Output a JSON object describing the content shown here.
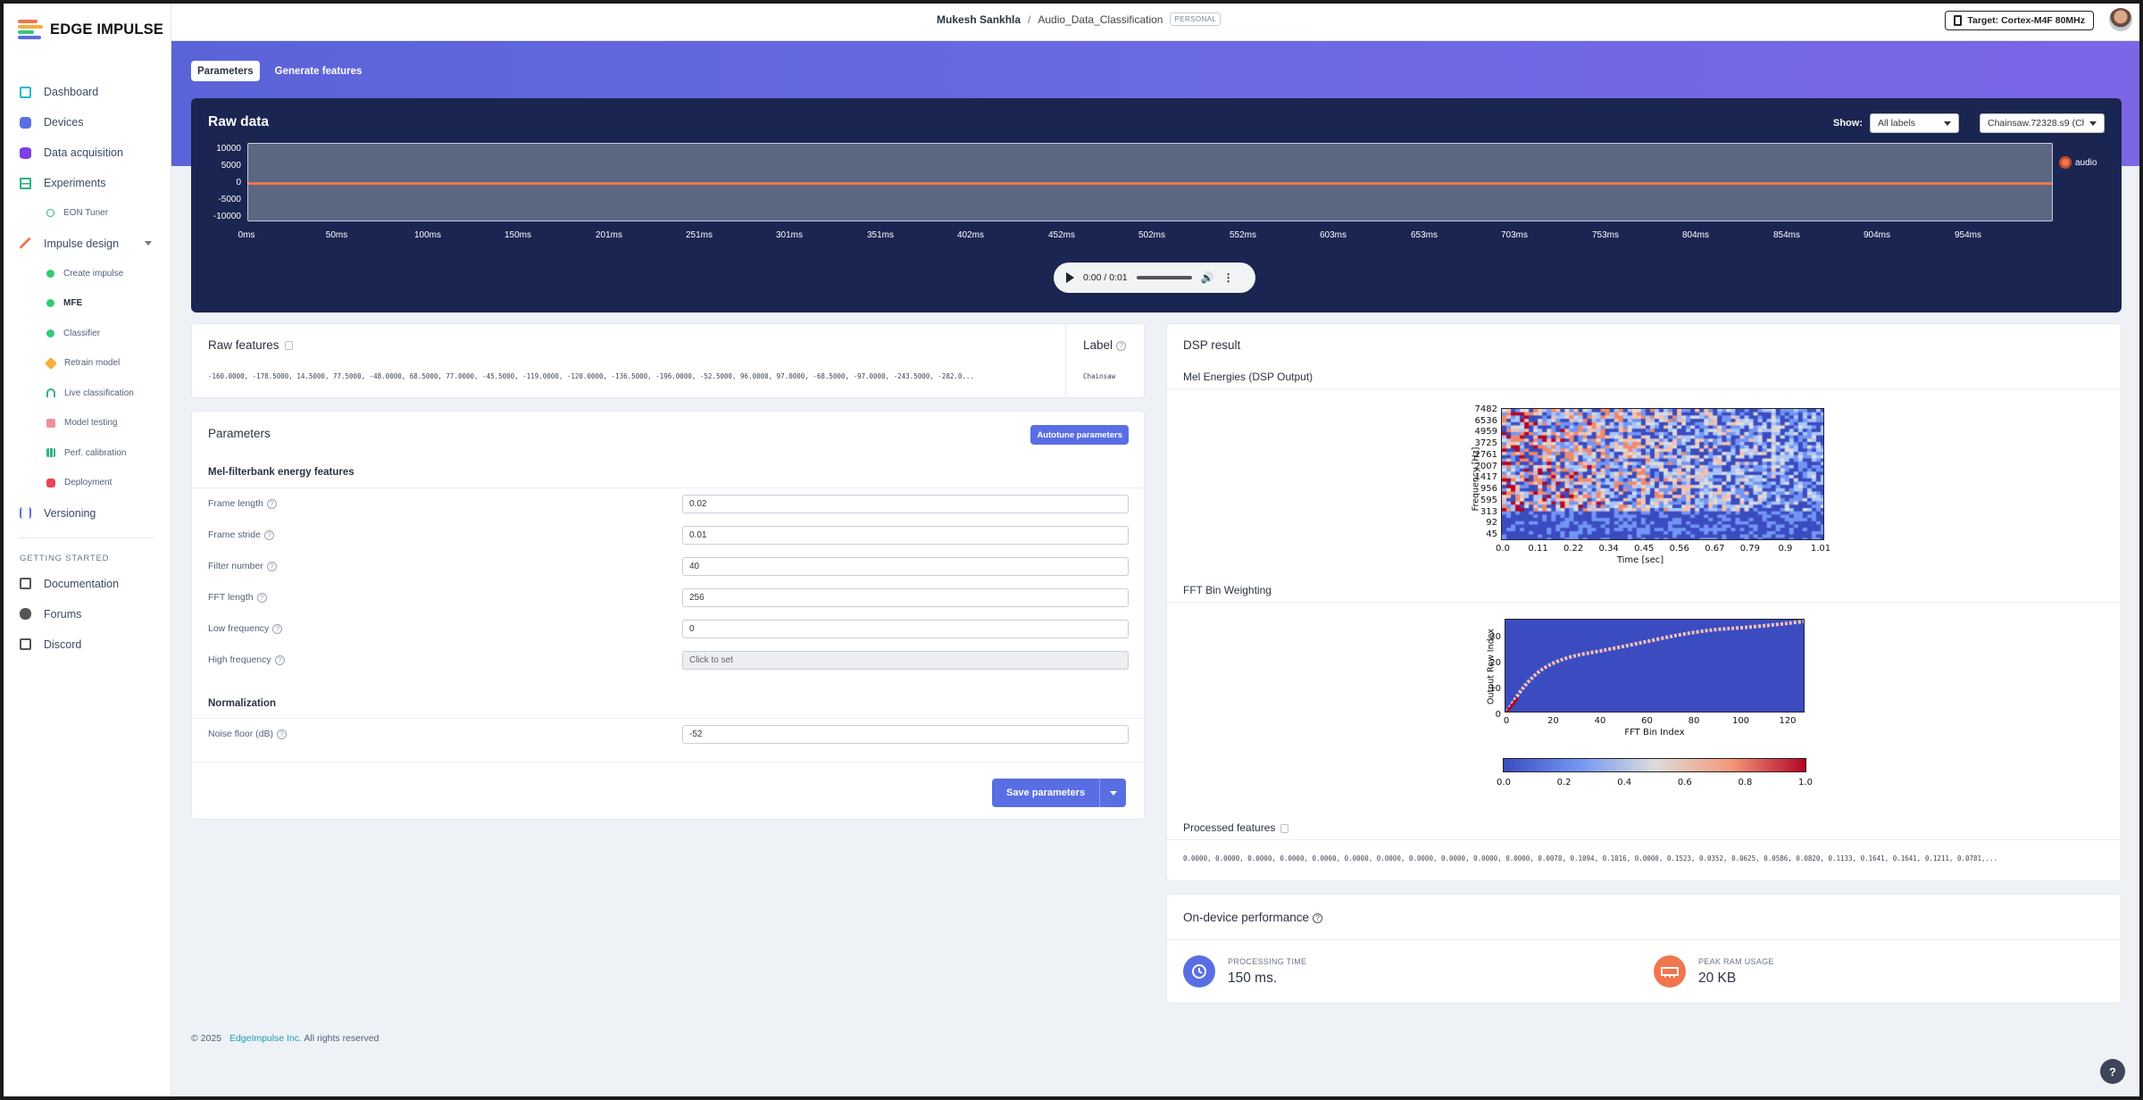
{
  "app": {
    "logo_text": "EDGE IMPULSE",
    "logo_colors": [
      "#f0764e",
      "#f4b03e",
      "#37c87a",
      "#5a6ee3"
    ]
  },
  "sidebar": {
    "items": [
      {
        "label": "Dashboard",
        "icon": "monitor-icon",
        "color": "#22b8cf"
      },
      {
        "label": "Devices",
        "icon": "devices-icon",
        "color": "#5a6ee3"
      },
      {
        "label": "Data acquisition",
        "icon": "database-icon",
        "color": "#7b3fe4"
      },
      {
        "label": "Experiments",
        "icon": "table-icon",
        "color": "#2fb380"
      }
    ],
    "eon": {
      "label": "EON Tuner",
      "icon": "eon-tuner-icon"
    },
    "impulse": {
      "label": "Impulse design",
      "icon": "pulse-icon"
    },
    "impulse_sub": [
      {
        "label": "Create impulse",
        "color": "#37c87a"
      },
      {
        "label": "MFE",
        "color": "#37c87a"
      },
      {
        "label": "Classifier",
        "color": "#37c87a"
      }
    ],
    "other_sub": [
      {
        "label": "Retrain model",
        "color": "#f4b03e"
      },
      {
        "label": "Live classification",
        "color": "#2fb380"
      },
      {
        "label": "Model testing",
        "color": "#f08fa1"
      },
      {
        "label": "Perf. calibration",
        "color": "#2fb380"
      },
      {
        "label": "Deployment",
        "color": "#e8445a"
      }
    ],
    "versioning": "Versioning",
    "getting_started": "GETTING STARTED",
    "links": [
      "Documentation",
      "Forums",
      "Discord"
    ]
  },
  "topbar": {
    "user": "Mukesh Sankhla",
    "separator": "/",
    "project": "Audio_Data_Classification",
    "badge": "PERSONAL",
    "target": "Target: Cortex-M4F 80MHz"
  },
  "tabs": [
    "Parameters",
    "Generate features"
  ],
  "raw_data": {
    "title": "Raw data",
    "show_label": "Show:",
    "show_value": "All labels",
    "sample_value": "Chainsaw.72328.s9 (Ch",
    "y_ticks": [
      "10000",
      "5000",
      "0",
      "-5000",
      "-10000"
    ],
    "x_ticks": [
      "0ms",
      "50ms",
      "100ms",
      "150ms",
      "201ms",
      "251ms",
      "301ms",
      "351ms",
      "402ms",
      "452ms",
      "502ms",
      "552ms",
      "603ms",
      "653ms",
      "703ms",
      "753ms",
      "804ms",
      "854ms",
      "904ms",
      "954ms"
    ],
    "legend": "audio",
    "player_time": "0:00 / 0:01"
  },
  "raw_features": {
    "title": "Raw features",
    "values": "-160.0000, -178.5000, 14.5000, 77.5000, -48.0000, 68.5000, 77.0000, -45.5000, -119.0000, -120.0000, -136.5000, -196.0000, -52.5000, 96.0000, 97.0000, -68.5000, -97.0000, -243.5000, -282.0...",
    "label_title": "Label",
    "label_value": "Chainsaw"
  },
  "parameters": {
    "title": "Parameters",
    "autotune": "Autotune parameters",
    "section1": "Mel-filterbank energy features",
    "fields": [
      {
        "label": "Frame length",
        "value": "0.02"
      },
      {
        "label": "Frame stride",
        "value": "0.01"
      },
      {
        "label": "Filter number",
        "value": "40"
      },
      {
        "label": "FFT length",
        "value": "256"
      },
      {
        "label": "Low frequency",
        "value": "0"
      },
      {
        "label": "High frequency",
        "value": "Click to set"
      }
    ],
    "section2": "Normalization",
    "noise": {
      "label": "Noise floor (dB)",
      "value": "-52"
    },
    "save": "Save parameters"
  },
  "dsp": {
    "title": "DSP result",
    "mel_title": "Mel Energies (DSP Output)",
    "mel_yticks": [
      "7482",
      "6536",
      "4959",
      "3725",
      "2761",
      "2007",
      "1417",
      "956",
      "595",
      "313",
      "92",
      "45"
    ],
    "mel_xticks": [
      "0.0",
      "0.11",
      "0.22",
      "0.34",
      "0.45",
      "0.56",
      "0.67",
      "0.79",
      "0.9",
      "1.01"
    ],
    "mel_ylabel": "Frequency [Hz]",
    "mel_xlabel": "Time [sec]",
    "fft_title": "FFT Bin Weighting",
    "fft_yticks": [
      "30",
      "20",
      "10",
      "0"
    ],
    "fft_xticks": [
      "0",
      "20",
      "40",
      "60",
      "80",
      "100",
      "120"
    ],
    "fft_ylabel": "Output Row Index",
    "fft_xlabel": "FFT Bin Index",
    "cbar_ticks": [
      "0.0",
      "0.2",
      "0.4",
      "0.6",
      "0.8",
      "1.0"
    ],
    "processed_title": "Processed features",
    "processed_values": "0.0000, 0.0000, 0.0000, 0.0000, 0.0000, 0.0000, 0.0000, 0.0000, 0.0000, 0.0000, 0.0000, 0.0078, 0.1094, 0.1016, 0.0000, 0.1523, 0.0352, 0.0625, 0.0586, 0.0820, 0.1133, 0.1641, 0.1641, 0.1211, 0.0781,..."
  },
  "perf": {
    "title": "On-device performance",
    "items": [
      {
        "label": "PROCESSING TIME",
        "value": "150 ms."
      },
      {
        "label": "PEAK RAM USAGE",
        "value": "20 KB"
      }
    ]
  },
  "footer": {
    "copy": "© 2025",
    "company": "EdgeImpulse Inc.",
    "rights": "All rights reserved"
  },
  "help_fab": "?"
}
